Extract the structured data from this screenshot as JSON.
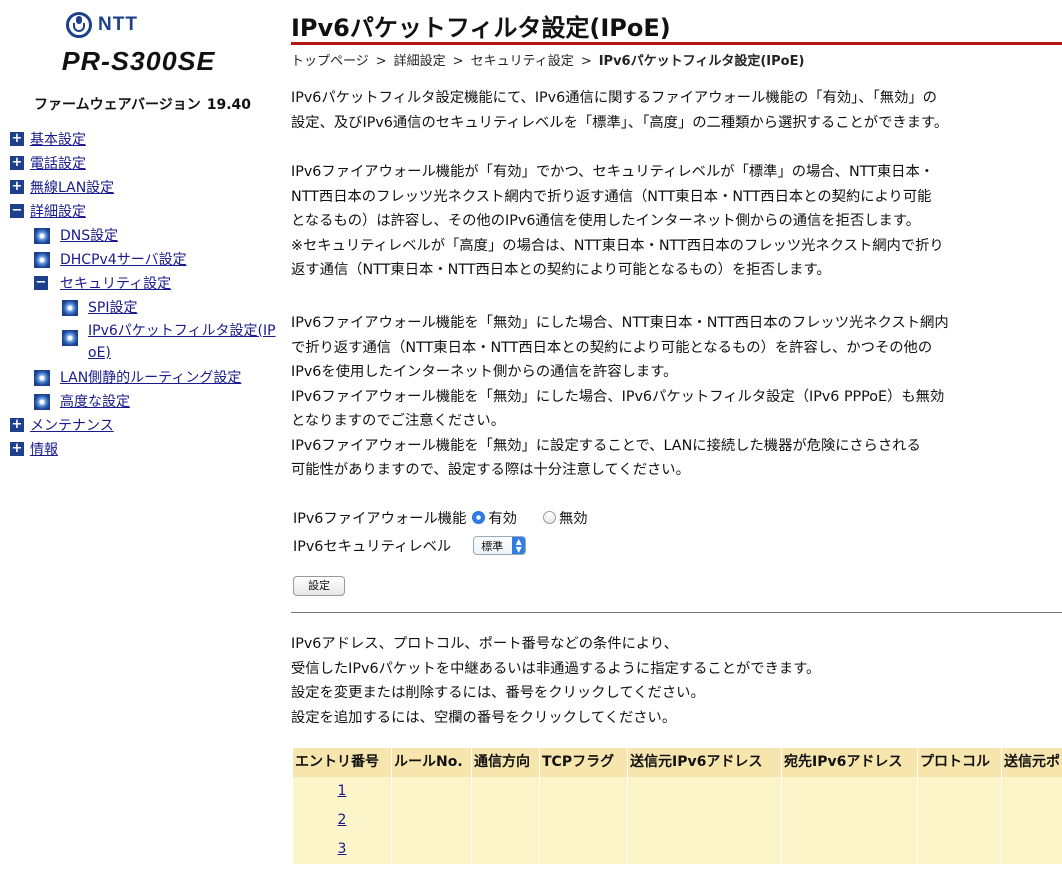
{
  "brand": {
    "logo_text": "NTT",
    "model": "PR-S300SE"
  },
  "firmware": {
    "label": "ファームウェアバージョン",
    "version": "19.40"
  },
  "sidebar": {
    "items": [
      {
        "label": "基本設定",
        "icon": "plus-icon"
      },
      {
        "label": "電話設定",
        "icon": "plus-icon"
      },
      {
        "label": "無線LAN設定",
        "icon": "plus-icon"
      },
      {
        "label": "詳細設定",
        "icon": "minus-icon"
      },
      {
        "label": "DNS設定",
        "icon": "bullet-icon"
      },
      {
        "label": "DHCPv4サーバ設定",
        "icon": "bullet-icon"
      },
      {
        "label": "セキュリティ設定",
        "icon": "minus-icon"
      },
      {
        "label": "SPI設定",
        "icon": "bullet-icon"
      },
      {
        "label": "IPv6パケットフィルタ設定(IPoE)",
        "line1": "IPv6パケットフィルタ設定(IP",
        "line2": "oE)",
        "icon": "bullet-icon"
      },
      {
        "label": "LAN側静的ルーティング設定",
        "icon": "bullet-icon"
      },
      {
        "label": "高度な設定",
        "icon": "bullet-icon"
      },
      {
        "label": "メンテナンス",
        "icon": "plus-icon"
      },
      {
        "label": "情報",
        "icon": "plus-icon"
      }
    ]
  },
  "page": {
    "title": "IPv6パケットフィルタ設定(IPoE)",
    "breadcrumb": [
      "トップページ",
      "詳細設定",
      "セキュリティ設定",
      "IPv6パケットフィルタ設定(IPoE)"
    ],
    "breadcrumb_sep": ">"
  },
  "description": {
    "p1": [
      "IPv6パケットフィルタ設定機能にて、IPv6通信に関するファイアウォール機能の「有効」、「無効」の",
      "設定、及びIPv6通信のセキュリティレベルを「標準」、「高度」の二種類から選択することができます。"
    ],
    "p2": [
      "IPv6ファイアウォール機能が「有効」でかつ、セキュリティレベルが「標準」の場合、NTT東日本・",
      "NTT西日本のフレッツ光ネクスト網内で折り返す通信（NTT東日本・NTT西日本との契約により可能",
      "となるもの）は許容し、その他のIPv6通信を使用したインターネット側からの通信を拒否します。",
      "※セキュリティレベルが「高度」の場合は、NTT東日本・NTT西日本のフレッツ光ネクスト網内で折り",
      "返す通信（NTT東日本・NTT西日本との契約により可能となるもの）を拒否します。"
    ],
    "p3": [
      "IPv6ファイアウォール機能を「無効」にした場合、NTT東日本・NTT西日本のフレッツ光ネクスト網内",
      "で折り返す通信（NTT東日本・NTT西日本との契約により可能となるもの）を許容し、かつその他の",
      "IPv6を使用したインターネット側からの通信を許容します。",
      "IPv6ファイアウォール機能を「無効」にした場合、IPv6パケットフィルタ設定（IPv6 PPPoE）も無効",
      "となりますのでご注意ください。",
      "IPv6ファイアウォール機能を「無効」に設定することで、LANに接続した機器が危険にさらされる",
      "可能性がありますので、設定する際は十分注意してください。"
    ]
  },
  "form": {
    "firewall_label": "IPv6ファイアウォール機能",
    "firewall_options": [
      "有効",
      "無効"
    ],
    "firewall_selected": "有効",
    "level_label": "IPv6セキュリティレベル",
    "level_value": "標準",
    "submit_label": "設定"
  },
  "filter_intro": [
    "IPv6アドレス、プロトコル、ポート番号などの条件により、",
    "受信したIPv6パケットを中継あるいは非通過するように指定することができます。",
    "設定を変更または削除するには、番号をクリックしてください。",
    "設定を追加するには、空欄の番号をクリックしてください。"
  ],
  "table": {
    "columns": [
      "エントリ番号",
      "ルールNo.",
      "通信方向",
      "TCPフラグ",
      "送信元IPv6アドレス",
      "宛先IPv6アドレス",
      "プロトコル",
      "送信元ポ"
    ],
    "rows": [
      {
        "entry": "1"
      },
      {
        "entry": "2"
      },
      {
        "entry": "3"
      }
    ]
  },
  "colors": {
    "accent_rule": "#b31515",
    "header_bg": "#f6e6ad",
    "row_bg": "#fcf5c9",
    "link": "#1a1a8c",
    "nav_icon": "#1d3f8c"
  }
}
